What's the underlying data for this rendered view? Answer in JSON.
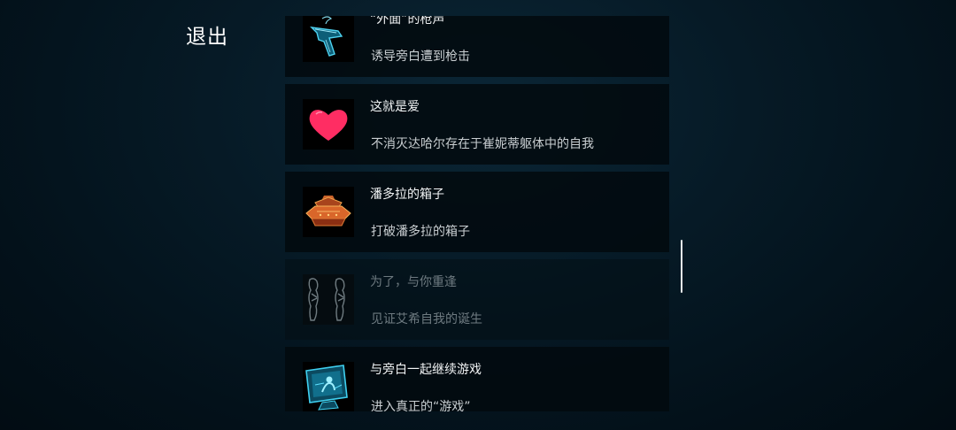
{
  "header": {
    "exit_label": "退出"
  },
  "achievements": [
    {
      "title": "“外面”的枪声",
      "description": "诱导旁白遭到枪击",
      "icon": "gun-icon",
      "locked": false
    },
    {
      "title": "这就是爱",
      "description": "不消灭达哈尔存在于崔妮蒂躯体中的自我",
      "icon": "heart-icon",
      "locked": false
    },
    {
      "title": "潘多拉的箱子",
      "description": "打破潘多拉的箱子",
      "icon": "pandora-box-icon",
      "locked": false
    },
    {
      "title": "为了，与你重逢",
      "description": "见证艾希自我的诞生",
      "icon": "twin-figures-icon",
      "locked": true
    },
    {
      "title": "与旁白一起继续游戏",
      "description": "进入真正的“游戏”",
      "icon": "monitor-icon",
      "locked": false
    }
  ],
  "colors": {
    "background": "#03121b",
    "card": "#020a0f",
    "heart": "#ff2d63",
    "cyan_accent": "#2fc3e6",
    "box_orange": "#e06a2a"
  }
}
